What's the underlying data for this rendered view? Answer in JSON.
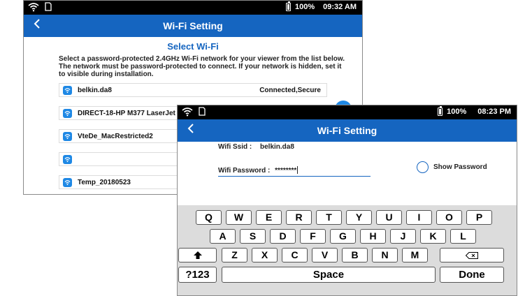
{
  "back_screen": {
    "status": {
      "battery": "100%",
      "time": "09:32 AM"
    },
    "title": "Wi-Fi Setting",
    "heading": "Select Wi-Fi",
    "description": "Select a password-protected 2.4GHz Wi-Fi network for your viewer from the list below. The network must be password-protected to connect. If your network is hidden, set it to visible during installation.",
    "networks": [
      {
        "name": "belkin.da8",
        "status": "Connected,Secure"
      },
      {
        "name": "DIRECT-18-HP M377 LaserJet",
        "status": ""
      },
      {
        "name": "VteDe_MacRestricted2",
        "status": ""
      },
      {
        "name": "",
        "status": ""
      },
      {
        "name": "Temp_20180523",
        "status": ""
      }
    ]
  },
  "front_screen": {
    "status": {
      "battery": "100%",
      "time": "08:23 PM"
    },
    "title": "Wi-Fi Setting",
    "ssid_label": "Wifi Ssid :",
    "ssid_value": "belkin.da8",
    "password_label": "Wifi Password :",
    "password_value": "********",
    "show_password_label": "Show Password",
    "keyboard": {
      "row1": [
        "Q",
        "W",
        "E",
        "R",
        "T",
        "Y",
        "U",
        "I",
        "O",
        "P"
      ],
      "row2": [
        "A",
        "S",
        "D",
        "F",
        "G",
        "H",
        "J",
        "K",
        "L"
      ],
      "row3": [
        "Z",
        "X",
        "C",
        "V",
        "B",
        "N",
        "M"
      ],
      "numbers_key": "?123",
      "space_key": "Space",
      "done_key": "Done"
    }
  },
  "colors": {
    "accent": "#1565c0",
    "wifi_icon": "#1e88e5",
    "keyboard_bg": "#dcdcdc"
  }
}
